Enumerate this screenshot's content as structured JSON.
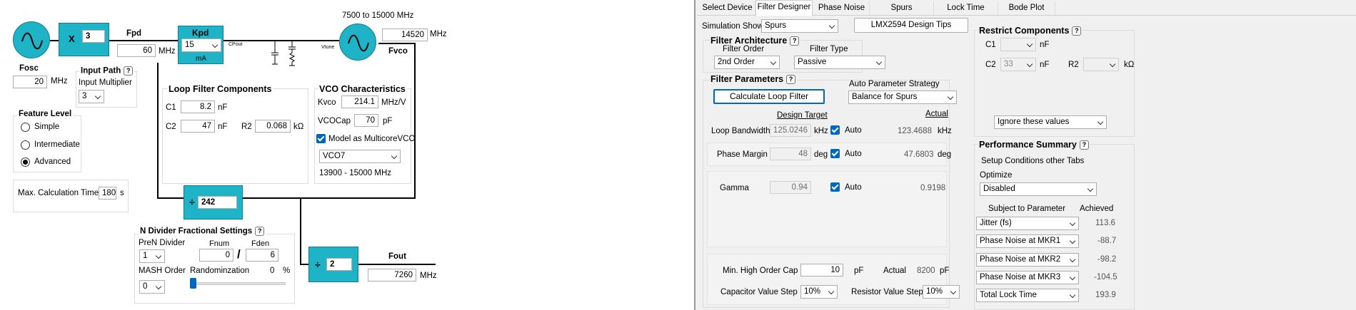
{
  "pll": {
    "fosc_label": "Fosc",
    "fosc_value": "20",
    "fosc_unit": "MHz",
    "mult_symbol": "X",
    "mult_value": "3",
    "fpd_label": "Fpd",
    "fpd_value": "60",
    "fpd_unit": "MHz",
    "kpd_label": "Kpd",
    "kpd_value": "15",
    "kpd_unit": "mA",
    "cpout_label": "CPout",
    "vtune_label": "Vtune",
    "vco_range": "7500 to 15000 MHz",
    "vco_value": "14520",
    "vco_unit": "MHz",
    "fvco_label": "Fvco",
    "input_path_title": "Input Path",
    "input_multiplier_label": "Input Multiplier",
    "input_multiplier_value": "3",
    "feature_level_title": "Feature Level",
    "feature_levels": [
      "Simple",
      "Intermediate",
      "Advanced"
    ],
    "max_calc_label": "Max. Calculation Time",
    "max_calc_value": "180",
    "max_calc_unit": "s",
    "ndiv_symbol": "÷",
    "ndiv_value": "242",
    "outdiv_value": "2",
    "fout_label": "Fout",
    "fout_value": "7260",
    "fout_unit": "MHz",
    "help_glyph": "?"
  },
  "loop_filter": {
    "title": "Loop Filter Components",
    "c1_label": "C1",
    "c1_value": "8.2",
    "c1_unit": "nF",
    "c2_label": "C2",
    "c2_value": "47",
    "c2_unit": "nF",
    "r2_label": "R2",
    "r2_value": "0.068",
    "r2_unit": "kΩ"
  },
  "vco_char": {
    "title": "VCO Characteristics",
    "kvco_label": "Kvco",
    "kvco_value": "214.1",
    "kvco_unit": "MHz/V",
    "vcocap_label": "VCOCap",
    "vcocap_value": "70",
    "vcocap_unit": "pF",
    "multicore_label": "Model as MulticoreVCO",
    "vco_select": "VCO7",
    "vco_select_range": "13900 - 15000 MHz"
  },
  "ndiv_frac": {
    "title": "N Divider Fractional Settings",
    "pren_label": "PreN Divider",
    "pren_value": "1",
    "fnum_label": "Fnum",
    "fnum_value": "0",
    "fden_label": "Fden",
    "fden_value": "6",
    "slash": "/",
    "mash_label": "MASH Order",
    "mash_value": "0",
    "rand_label": "Randominzation",
    "rand_value": "0",
    "rand_unit": "%"
  },
  "tabs": [
    "Select Device",
    "Filter Designer",
    "Phase Noise",
    "Spurs",
    "Lock Time",
    "Bode Plot"
  ],
  "active_tab": "Filter Designer",
  "sim": {
    "label": "Simulation Shown",
    "value": "Spurs",
    "tips_button": "LMX2594 Design Tips"
  },
  "arch": {
    "title": "Filter Architecture",
    "order_label": "Filter Order",
    "order_value": "2nd Order",
    "type_label": "Filter Type",
    "type_value": "Passive"
  },
  "params": {
    "title": "Filter Parameters",
    "calc_button": "Calculate Loop Filter",
    "strategy_label": "Auto Parameter Strategy",
    "strategy_value": "Balance for Spurs",
    "design_target_header": "Design Target",
    "actual_header": "Actual",
    "bw_label": "Loop Bandwidth",
    "bw_target": "125.0246",
    "bw_unit": "kHz",
    "bw_auto": "Auto",
    "bw_actual": "123.4688",
    "bw_actual_unit": "kHz",
    "pm_label": "Phase Margin",
    "pm_target": "48",
    "pm_unit": "deg",
    "pm_auto": "Auto",
    "pm_actual": "47.6803",
    "pm_actual_unit": "deg",
    "gamma_label": "Gamma",
    "gamma_target": "0.94",
    "gamma_auto": "Auto",
    "gamma_actual": "0.9198",
    "min_cap_label": "Min. High Order Cap",
    "min_cap_value": "10",
    "min_cap_unit": "pF",
    "min_cap_actual_label": "Actual",
    "min_cap_actual": "8200",
    "min_cap_actual_unit": "pF",
    "cap_step_label": "Capacitor Value Step",
    "cap_step_value": "10%",
    "res_step_label": "Resistor Value Step",
    "res_step_value": "10%"
  },
  "restrict": {
    "title": "Restrict Components",
    "c1_label": "C1",
    "c1_value": "",
    "c1_unit": "nF",
    "c2_label": "C2",
    "c2_value": "33",
    "c2_unit": "nF",
    "r2_label": "R2",
    "r2_value": "",
    "r2_unit": "kΩ",
    "mode_value": "Ignore these values"
  },
  "perf": {
    "title": "Performance Summary",
    "setup_label": "Setup Conditions other Tabs",
    "optimize_label": "Optimize",
    "optimize_value": "Disabled",
    "subject_header": "Subject to Parameter",
    "achieved_header": "Achieved",
    "rows": [
      {
        "param": "Jitter (fs)",
        "value": "113.6"
      },
      {
        "param": "Phase Noise at MKR1",
        "value": "-88.7"
      },
      {
        "param": "Phase Noise at MKR2",
        "value": "-98.2"
      },
      {
        "param": "Phase Noise at MKR3",
        "value": "-104.5"
      },
      {
        "param": "Total Lock Time",
        "value": "193.9"
      }
    ]
  }
}
